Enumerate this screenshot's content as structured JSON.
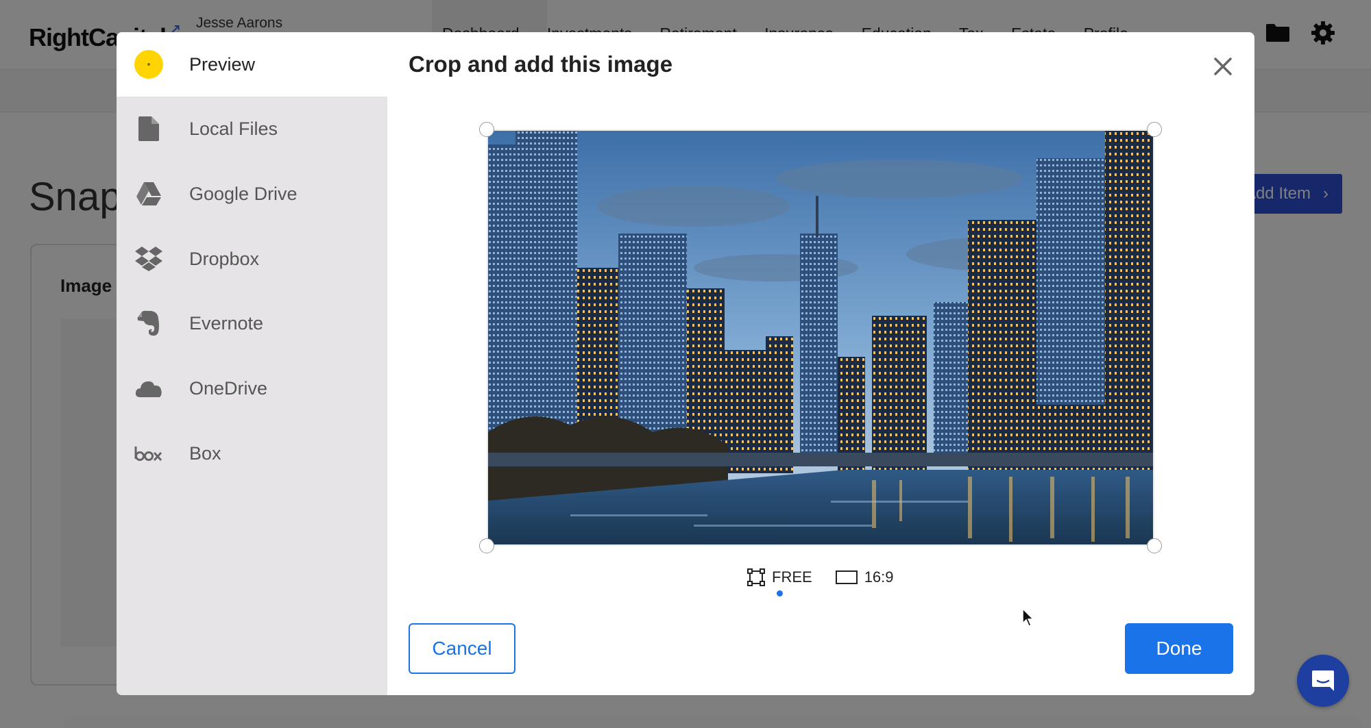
{
  "app": {
    "logo": "RightCapital",
    "client_name": "Jesse Aarons",
    "nav_items": [
      "Dashboard",
      "Investments",
      "Retirement",
      "Insurance",
      "Education",
      "Tax",
      "Estate",
      "Profile"
    ],
    "page_title": "Snapshot",
    "add_item_label": "Add Item",
    "card_title": "Image"
  },
  "modal": {
    "title": "Crop and add this image",
    "sources": [
      {
        "label": "Preview",
        "icon": "preview-dot-icon",
        "active": true
      },
      {
        "label": "Local Files",
        "icon": "file-icon",
        "active": false
      },
      {
        "label": "Google Drive",
        "icon": "google-drive-icon",
        "active": false
      },
      {
        "label": "Dropbox",
        "icon": "dropbox-icon",
        "active": false
      },
      {
        "label": "Evernote",
        "icon": "evernote-icon",
        "active": false
      },
      {
        "label": "OneDrive",
        "icon": "onedrive-icon",
        "active": false
      },
      {
        "label": "Box",
        "icon": "box-icon",
        "active": false
      }
    ],
    "ratios": [
      {
        "label": "FREE",
        "icon": "crop-free-icon",
        "selected": true
      },
      {
        "label": "16:9",
        "icon": "aspect-ratio-icon",
        "selected": false
      }
    ],
    "cancel_label": "Cancel",
    "done_label": "Done",
    "preview_image": "city-skyline-river-photo"
  },
  "colors": {
    "accent": "#1a73e8",
    "preview_dot": "#ffd400",
    "sidebar_bg": "#e6e4e6",
    "add_item_bg": "#2c4fd4",
    "chat_bg": "#1e3ea0"
  }
}
